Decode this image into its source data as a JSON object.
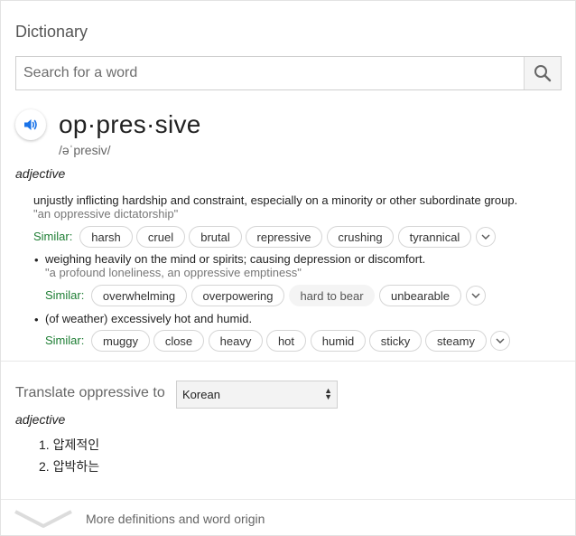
{
  "panel": {
    "title": "Dictionary"
  },
  "search": {
    "placeholder": "Search for a word",
    "icon": "search-icon"
  },
  "entry": {
    "word": "op·pres·sive",
    "phonetic": "/əˈpresiv/",
    "pos": "adjective",
    "similar_label": "Similar:",
    "senses": [
      {
        "definition": "unjustly inflicting hardship and constraint, especially on a minority or other subordinate group.",
        "example": "\"an oppressive dictatorship\"",
        "similar": [
          "harsh",
          "cruel",
          "brutal",
          "repressive",
          "crushing",
          "tyrannical"
        ]
      },
      {
        "bullet": "•",
        "definition": "weighing heavily on the mind or spirits; causing depression or discomfort.",
        "example": "\"a profound loneliness, an oppressive emptiness\"",
        "similar": [
          "overwhelming",
          "overpowering",
          "hard to bear",
          "unbearable"
        ]
      },
      {
        "bullet": "•",
        "definition": "(of weather) excessively hot and humid.",
        "similar": [
          "muggy",
          "close",
          "heavy",
          "hot",
          "humid",
          "sticky",
          "steamy"
        ]
      }
    ]
  },
  "translate": {
    "label": "Translate oppressive to",
    "language": "Korean",
    "pos": "adjective",
    "items": [
      "1. 압제적인",
      "2. 압박하는"
    ]
  },
  "footer": {
    "more_label": "More definitions and word origin"
  },
  "colors": {
    "similar": "#1e7e34",
    "speaker": "#1a73e8"
  }
}
